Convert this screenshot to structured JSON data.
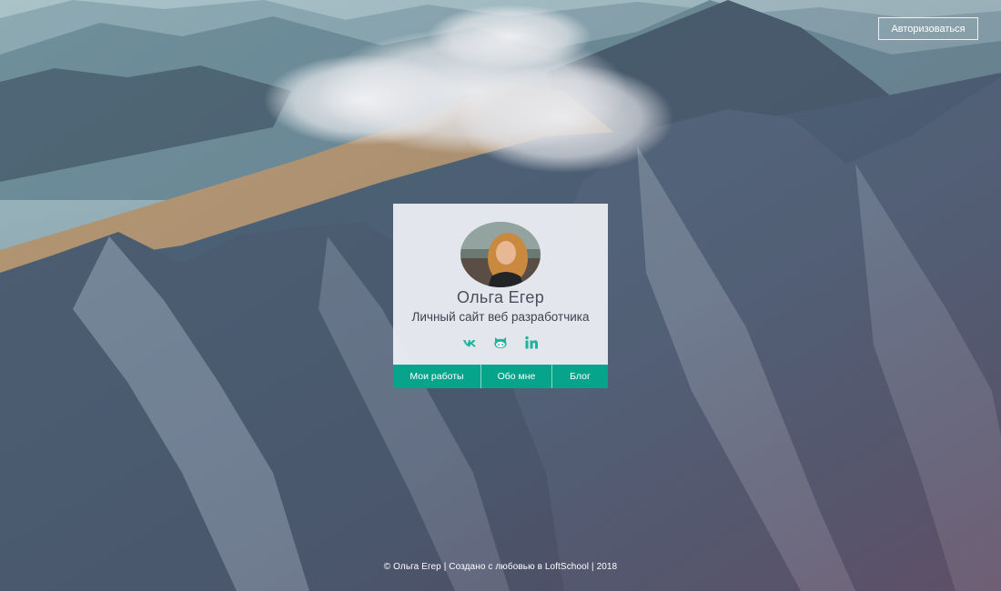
{
  "header": {
    "auth_label": "Авторизоваться"
  },
  "profile": {
    "name": "Ольга Егер",
    "subtitle": "Личный сайт веб разработчика",
    "socials": [
      {
        "icon": "vk-icon"
      },
      {
        "icon": "github-icon"
      },
      {
        "icon": "linkedin-icon"
      }
    ]
  },
  "nav": {
    "items": [
      {
        "label": "Мои работы"
      },
      {
        "label": "Обо мне"
      },
      {
        "label": "Блог"
      }
    ]
  },
  "footer": {
    "copyright": "© Ольга Егер | Создано с любовью в LoftSchool | 2018"
  },
  "colors": {
    "accent": "#07a48b",
    "social_icon": "#1cb49a",
    "card_background": "#f0f2f6",
    "text_dark": "#4a4f5c"
  }
}
